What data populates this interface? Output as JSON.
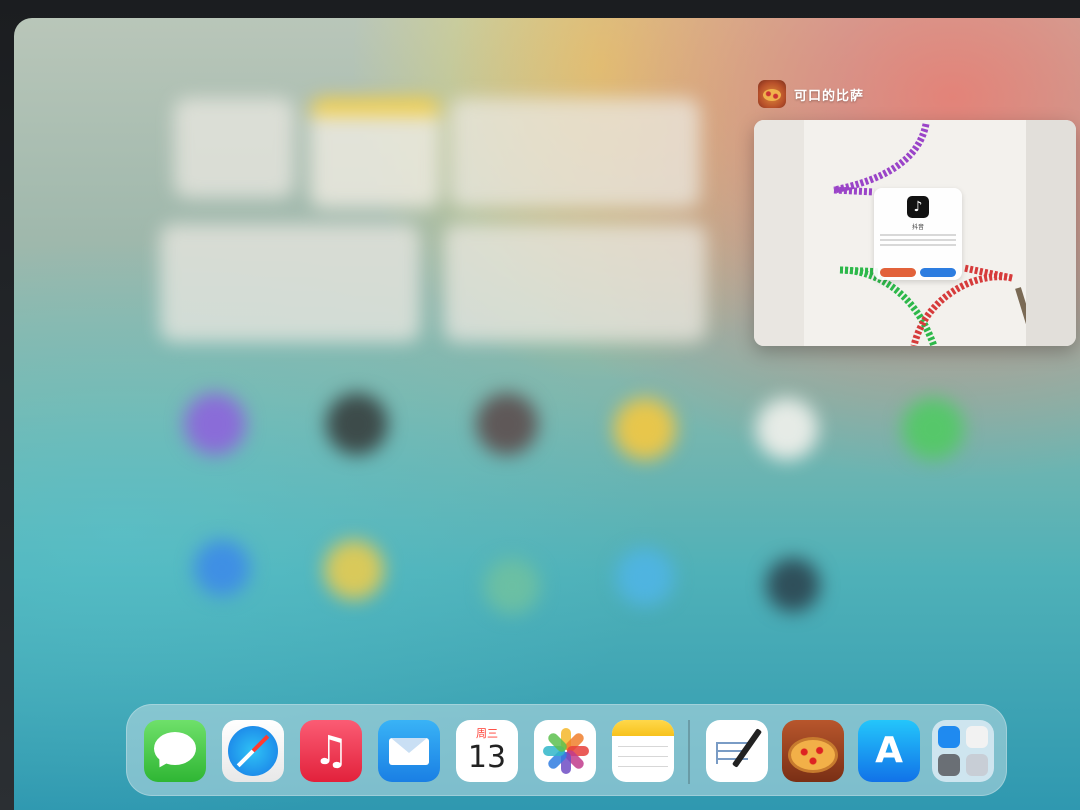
{
  "switcher": {
    "app_name": "可口的比萨",
    "app_icon": "pizza-app-icon",
    "thumbnail": {
      "dialog_title": "抖音",
      "cancel_label": "",
      "open_label": ""
    }
  },
  "dock": {
    "apps": [
      {
        "name": "Messages",
        "icon": "messages-icon"
      },
      {
        "name": "Safari",
        "icon": "safari-icon"
      },
      {
        "name": "Music",
        "icon": "music-icon",
        "glyph": "♫"
      },
      {
        "name": "Mail",
        "icon": "mail-icon"
      },
      {
        "name": "Calendar",
        "icon": "calendar-icon",
        "day": "周三",
        "date": "13"
      },
      {
        "name": "Photos",
        "icon": "photos-icon"
      },
      {
        "name": "Notes",
        "icon": "notes-icon"
      },
      {
        "name": "Freeform",
        "icon": "freeform-icon"
      },
      {
        "name": "可口的比萨",
        "icon": "pizza-icon"
      },
      {
        "name": "App Store",
        "icon": "app-store-icon",
        "glyph": "A"
      },
      {
        "name": "App Library",
        "icon": "app-library-icon"
      }
    ]
  },
  "colors": {
    "messages_green": "#2fb634",
    "music_red": "#e2213b",
    "mail_blue": "#1a7fe4",
    "calendar_red": "#ff3b30",
    "notes_yellow": "#f7c21d",
    "app_store_blue": "#1172e8",
    "dialog_cancel": "#e2623a",
    "dialog_open": "#2d7de0"
  }
}
